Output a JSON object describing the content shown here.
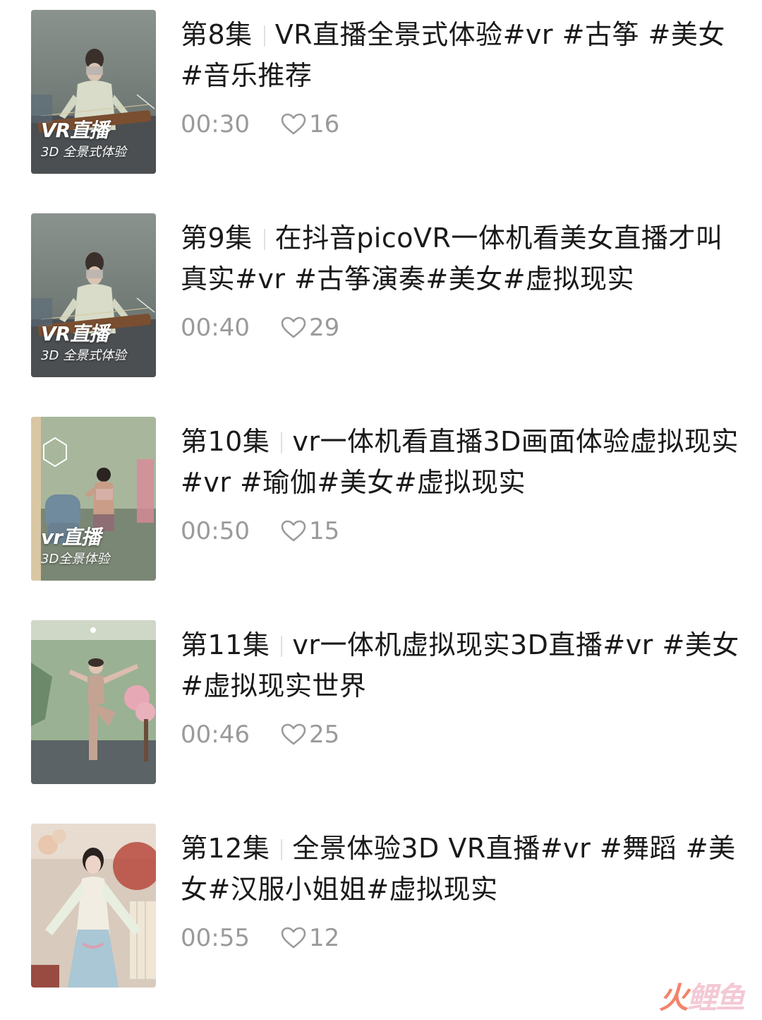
{
  "episodes": [
    {
      "episode": "第8集",
      "title": "VR直播全景式体验#vr #古筝 #美女#音乐推荐",
      "duration": "00:30",
      "likes": "16",
      "thumb_caption_main": "VR直播",
      "thumb_caption_sub": "3D 全景式体验",
      "thumb_scene": "guzheng"
    },
    {
      "episode": "第9集",
      "title": "在抖音picoVR一体机看美女直播才叫真实#vr #古筝演奏#美女#虚拟现实",
      "duration": "00:40",
      "likes": "29",
      "thumb_caption_main": "VR直播",
      "thumb_caption_sub": "3D 全景式体验",
      "thumb_scene": "guzheng"
    },
    {
      "episode": "第10集",
      "title": "vr一体机看直播3D画面体验虚拟现实#vr #瑜伽#美女#虚拟现实",
      "duration": "00:50",
      "likes": "15",
      "thumb_caption_main": "vr直播",
      "thumb_caption_sub": "3D全景体验",
      "thumb_scene": "yoga-back"
    },
    {
      "episode": "第11集",
      "title": "vr一体机虚拟现实3D直播#vr #美女#虚拟现实世界",
      "duration": "00:46",
      "likes": "25",
      "thumb_caption_main": "",
      "thumb_caption_sub": "",
      "thumb_scene": "yoga-pose"
    },
    {
      "episode": "第12集",
      "title": "全景体验3D VR直播#vr #舞蹈 #美女#汉服小姐姐#虚拟现实",
      "duration": "00:55",
      "likes": "12",
      "thumb_caption_main": "",
      "thumb_caption_sub": "",
      "thumb_scene": "hanfu"
    }
  ],
  "watermark": {
    "fire": "火",
    "rest": "鲤鱼"
  },
  "colors": {
    "title_text": "#1a1a1a",
    "meta_text": "#9a9a9a",
    "separator": "#e0e0e0",
    "background": "#ffffff"
  },
  "icons": {
    "like": "heart-outline-icon"
  }
}
